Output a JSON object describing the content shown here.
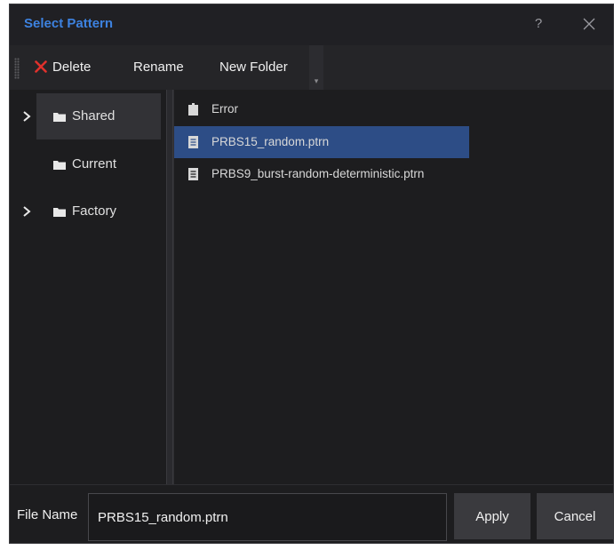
{
  "dialog": {
    "title": "Select Pattern",
    "help_label": "?"
  },
  "toolbar": {
    "delete_label": "Delete",
    "rename_label": "Rename",
    "new_folder_label": "New Folder"
  },
  "tree": {
    "items": [
      {
        "label": "Shared",
        "expandable": true,
        "selected": true
      },
      {
        "label": "Current",
        "expandable": false,
        "selected": false
      },
      {
        "label": "Factory",
        "expandable": true,
        "selected": false
      }
    ]
  },
  "files": {
    "items": [
      {
        "label": "Error",
        "icon": "folder-icon",
        "selected": false
      },
      {
        "label": "PRBS15_random.ptrn",
        "icon": "file-icon",
        "selected": true
      },
      {
        "label": "PRBS9_burst-random-deterministic.ptrn",
        "icon": "file-icon",
        "selected": false
      }
    ]
  },
  "footer": {
    "file_name_label": "File Name",
    "file_name_value": "PRBS15_random.ptrn",
    "apply_label": "Apply",
    "cancel_label": "Cancel"
  },
  "colors": {
    "title": "#3d82e0",
    "selection": "#2d4d86",
    "delete_icon": "#e0312c",
    "background": "#1d1d1f"
  }
}
